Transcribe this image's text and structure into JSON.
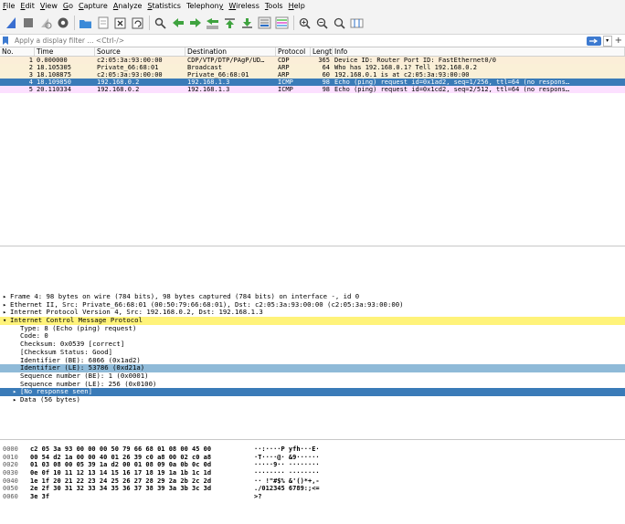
{
  "menu": [
    {
      "pre": "",
      "u": "F",
      "post": "ile"
    },
    {
      "pre": "",
      "u": "E",
      "post": "dit"
    },
    {
      "pre": "",
      "u": "V",
      "post": "iew"
    },
    {
      "pre": "",
      "u": "G",
      "post": "o"
    },
    {
      "pre": "",
      "u": "C",
      "post": "apture"
    },
    {
      "pre": "",
      "u": "A",
      "post": "nalyze"
    },
    {
      "pre": "",
      "u": "S",
      "post": "tatistics"
    },
    {
      "pre": "Telephon",
      "u": "y",
      "post": ""
    },
    {
      "pre": "",
      "u": "W",
      "post": "ireless"
    },
    {
      "pre": "",
      "u": "T",
      "post": "ools"
    },
    {
      "pre": "",
      "u": "H",
      "post": "elp"
    }
  ],
  "filter": {
    "placeholder": "Apply a display filter ... <Ctrl-/>"
  },
  "columns": {
    "no": "No.",
    "time": "Time",
    "source": "Source",
    "destination": "Destination",
    "protocol": "Protocol",
    "length": "Length",
    "info": "Info"
  },
  "packets": [
    {
      "no": "1",
      "time": "0.000000",
      "source": "c2:05:3a:93:00:00",
      "destination": "CDP/VTP/DTP/PAgP/UD…",
      "protocol": "CDP",
      "length": "365",
      "info": "Device ID: Router  Port ID: FastEthernet0/0",
      "style": "cdp"
    },
    {
      "no": "2",
      "time": "18.105305",
      "source": "Private_66:68:01",
      "destination": "Broadcast",
      "protocol": "ARP",
      "length": "64",
      "info": "Who has 192.168.0.1? Tell 192.168.0.2",
      "style": "arp"
    },
    {
      "no": "3",
      "time": "18.108875",
      "source": "c2:05:3a:93:00:00",
      "destination": "Private_66:68:01",
      "protocol": "ARP",
      "length": "60",
      "info": "192.168.0.1 is at c2:05:3a:93:00:00",
      "style": "arp"
    },
    {
      "no": "4",
      "time": "18.109850",
      "source": "192.168.0.2",
      "destination": "192.168.1.3",
      "protocol": "ICMP",
      "length": "98",
      "info": "Echo (ping) request  id=0x1ad2, seq=1/256, ttl=64 (no respons…",
      "style": "selected"
    },
    {
      "no": "5",
      "time": "20.110334",
      "source": "192.168.0.2",
      "destination": "192.168.1.3",
      "protocol": "ICMP",
      "length": "98",
      "info": "Echo (ping) request  id=0x1cd2, seq=2/512, ttl=64 (no respons…",
      "style": "icmp"
    }
  ],
  "details": [
    {
      "text": "Frame 4: 98 bytes on wire (784 bits), 98 bytes captured (784 bits) on interface -, id 0",
      "indent": 0,
      "arrow": "▸",
      "style": ""
    },
    {
      "text": "Ethernet II, Src: Private_66:68:01 (00:50:79:66:68:01), Dst: c2:05:3a:93:00:00 (c2:05:3a:93:00:00)",
      "indent": 0,
      "arrow": "▸",
      "style": ""
    },
    {
      "text": "Internet Protocol Version 4, Src: 192.168.0.2, Dst: 192.168.1.3",
      "indent": 0,
      "arrow": "▸",
      "style": ""
    },
    {
      "text": "Internet Control Message Protocol",
      "indent": 0,
      "arrow": "▾",
      "style": "yellow"
    },
    {
      "text": "Type: 8 (Echo (ping) request)",
      "indent": 1,
      "arrow": "",
      "style": ""
    },
    {
      "text": "Code: 0",
      "indent": 1,
      "arrow": "",
      "style": ""
    },
    {
      "text": "Checksum: 0x0539 [correct]",
      "indent": 1,
      "arrow": "",
      "style": ""
    },
    {
      "text": "[Checksum Status: Good]",
      "indent": 1,
      "arrow": "",
      "style": ""
    },
    {
      "text": "Identifier (BE): 6866 (0x1ad2)",
      "indent": 1,
      "arrow": "",
      "style": ""
    },
    {
      "text": "Identifier (LE): 53786 (0xd21a)",
      "indent": 1,
      "arrow": "",
      "style": "lightblue"
    },
    {
      "text": "Sequence number (BE): 1 (0x0001)",
      "indent": 1,
      "arrow": "",
      "style": ""
    },
    {
      "text": "Sequence number (LE): 256 (0x0100)",
      "indent": 1,
      "arrow": "",
      "style": ""
    },
    {
      "text": "[No response seen]",
      "indent": 1,
      "arrow": "▸",
      "style": "selected"
    },
    {
      "text": "Data (56 bytes)",
      "indent": 1,
      "arrow": "▸",
      "style": ""
    }
  ],
  "hex": [
    {
      "off": "0000",
      "bytes": "c2 05 3a 93 00 00 00 50  79 66 68 01 08 00 45 00",
      "ascii": "··:····P yfh···E·"
    },
    {
      "off": "0010",
      "bytes": "00 54 d2 1a 00 00 40 01  26 39 c0 a8 00 02 c0 a8",
      "ascii": "·T····@· &9······"
    },
    {
      "off": "0020",
      "bytes": "01 03 08 00 05 39 1a d2  00 01 08 09 0a 0b 0c 0d",
      "ascii": "·····9·· ········"
    },
    {
      "off": "0030",
      "bytes": "0e 0f 10 11 12 13 14 15  16 17 18 19 1a 1b 1c 1d",
      "ascii": "········ ········"
    },
    {
      "off": "0040",
      "bytes": "1e 1f 20 21 22 23 24 25  26 27 28 29 2a 2b 2c 2d",
      "ascii": "·· !\"#$% &'()*+,-"
    },
    {
      "off": "0050",
      "bytes": "2e 2f 30 31 32 33 34 35  36 37 38 39 3a 3b 3c 3d",
      "ascii": "./012345 6789:;<="
    },
    {
      "off": "0060",
      "bytes": "3e 3f",
      "ascii": ">?"
    }
  ],
  "colors": {
    "selected": "#3a7bb8",
    "cdp": "#fbeed8",
    "arp": "#faf0d7",
    "icmp": "#fce0ff",
    "yellow": "#fff37a",
    "lightblue": "#8fbad8"
  }
}
